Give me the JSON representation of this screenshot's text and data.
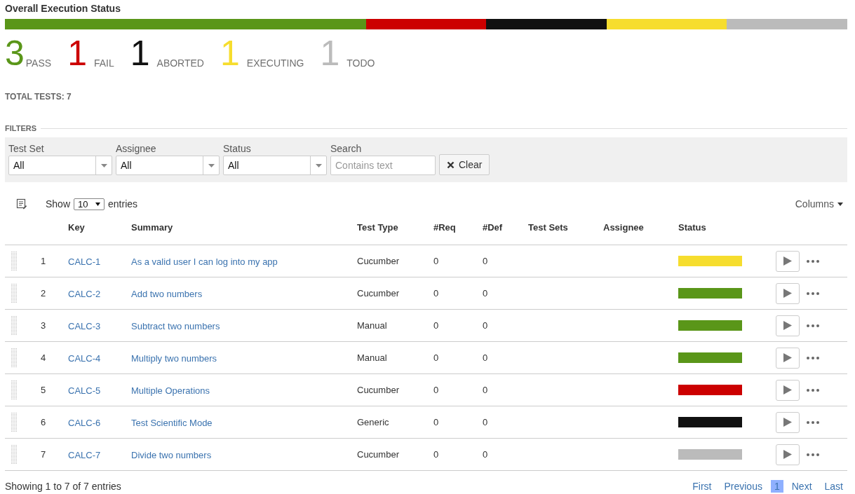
{
  "title": "Overall Execution Status",
  "summary": [
    {
      "count": "3",
      "label": "PASS",
      "color": "#5a9619"
    },
    {
      "count": "1",
      "label": "FAIL",
      "color": "#cc0000"
    },
    {
      "count": "1",
      "label": "ABORTED",
      "color": "#111111"
    },
    {
      "count": "1",
      "label": "EXECUTING",
      "color": "#f6dd2e"
    },
    {
      "count": "1",
      "label": "TODO",
      "color": "#bbbbbb"
    }
  ],
  "total_tests": "TOTAL TESTS: 7",
  "filters": {
    "heading": "FILTERS",
    "fields": [
      {
        "label": "Test Set",
        "kind": "select",
        "value": "All"
      },
      {
        "label": "Assignee",
        "kind": "select",
        "value": "All"
      },
      {
        "label": "Status",
        "kind": "select",
        "value": "All"
      },
      {
        "label": "Search",
        "kind": "text",
        "placeholder": "Contains text"
      }
    ],
    "clear_button": "Clear"
  },
  "length_menu": {
    "before": "Show",
    "value": "10",
    "after": "entries"
  },
  "columns_button": "Columns",
  "table": {
    "columns": [
      "Key",
      "Summary",
      "Test Type",
      "#Req",
      "#Def",
      "Test Sets",
      "Assignee",
      "Status"
    ],
    "rows": [
      {
        "index": "1",
        "key": "CALC-1",
        "summary": "As a valid user I can log into my app",
        "test_type": "Cucumber",
        "req": "0",
        "def": "0",
        "color": "#f6dd2e"
      },
      {
        "index": "2",
        "key": "CALC-2",
        "summary": "Add two numbers",
        "test_type": "Cucumber",
        "req": "0",
        "def": "0",
        "color": "#5a9619"
      },
      {
        "index": "3",
        "key": "CALC-3",
        "summary": "Subtract two numbers",
        "test_type": "Manual",
        "req": "0",
        "def": "0",
        "color": "#5a9619"
      },
      {
        "index": "4",
        "key": "CALC-4",
        "summary": "Multiply two numbers",
        "test_type": "Manual",
        "req": "0",
        "def": "0",
        "color": "#5a9619"
      },
      {
        "index": "5",
        "key": "CALC-5",
        "summary": "Multiple Operations",
        "test_type": "Cucumber",
        "req": "0",
        "def": "0",
        "color": "#cc0000"
      },
      {
        "index": "6",
        "key": "CALC-6",
        "summary": "Test Scientific Mode",
        "test_type": "Generic",
        "req": "0",
        "def": "0",
        "color": "#111111"
      },
      {
        "index": "7",
        "key": "CALC-7",
        "summary": "Divide two numbers",
        "test_type": "Cucumber",
        "req": "0",
        "def": "0",
        "color": "#bbbbbb"
      }
    ]
  },
  "info": "Showing 1 to 7 of 7 entries",
  "pagination": {
    "first": "First",
    "previous": "Previous",
    "pages": [
      {
        "label": "1",
        "selected": true
      }
    ],
    "next": "Next",
    "last": "Last"
  }
}
